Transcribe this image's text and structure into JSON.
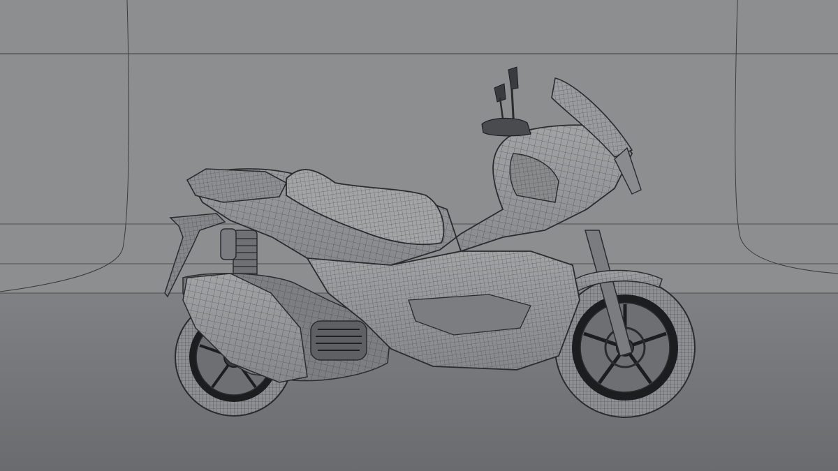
{
  "scene": {
    "background_color": "#8d8e90",
    "floor_color": "#747578",
    "line_color": "#2a2b2d",
    "model_fill": "#939496",
    "wheel_color": "#1c1d1f"
  }
}
